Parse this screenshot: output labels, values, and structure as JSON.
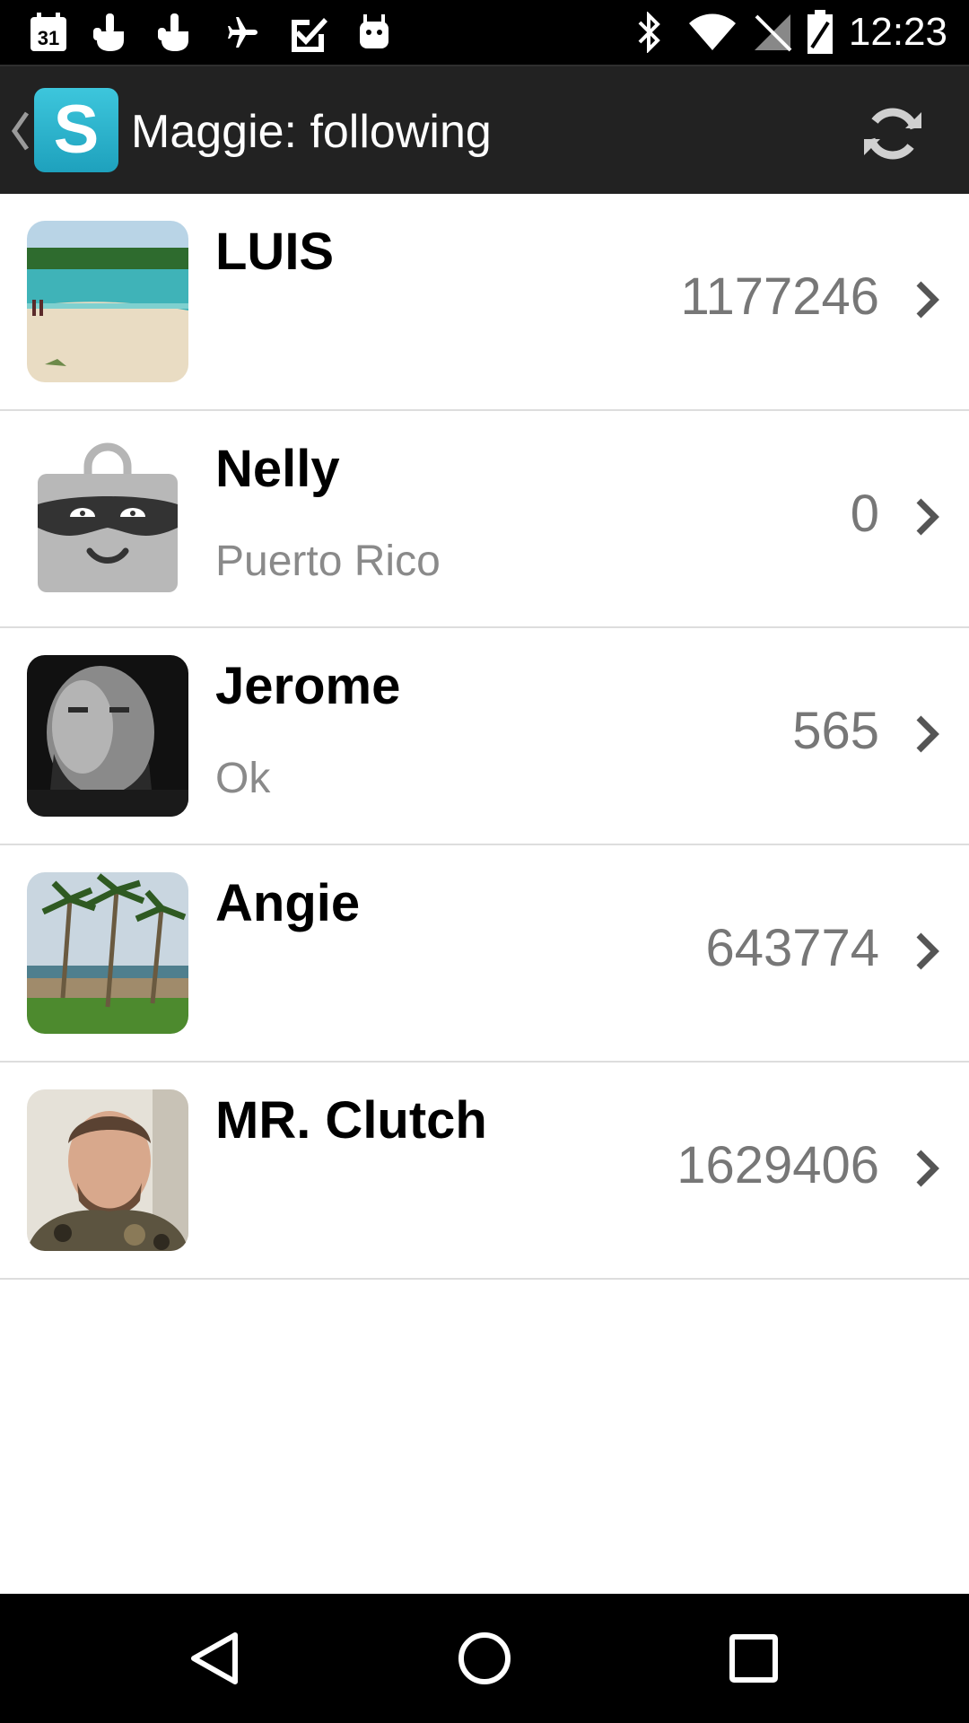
{
  "status_bar": {
    "time": "12:23",
    "left_icons": [
      "calendar-icon",
      "hand-icon",
      "hand-icon",
      "airplane-icon",
      "checkmark-icon",
      "android-icon"
    ],
    "calendar_day": "31",
    "right_icons": [
      "bluetooth-icon",
      "wifi-icon",
      "no-signal-icon",
      "battery-icon"
    ]
  },
  "action_bar": {
    "logo_letter": "S",
    "title": "Maggie: following",
    "refresh_icon": "refresh-icon",
    "colors": {
      "background": "#222222",
      "logo": "#2bb3cf"
    }
  },
  "users": [
    {
      "name": "LUIS",
      "subtitle": "",
      "count": "1177246",
      "avatar": "beach-photo"
    },
    {
      "name": "Nelly",
      "subtitle": "Puerto Rico",
      "count": "0",
      "avatar": "default-bandit-avatar"
    },
    {
      "name": "Jerome",
      "subtitle": "Ok",
      "count": "565",
      "avatar": "portrait-photo-bw"
    },
    {
      "name": "Angie",
      "subtitle": "",
      "count": "643774",
      "avatar": "palm-trees-photo"
    },
    {
      "name": "MR. Clutch",
      "subtitle": "",
      "count": "1629406",
      "avatar": "portrait-photo-camo"
    }
  ],
  "nav_bar": {
    "buttons": [
      "back-icon",
      "home-icon",
      "recents-icon"
    ]
  }
}
